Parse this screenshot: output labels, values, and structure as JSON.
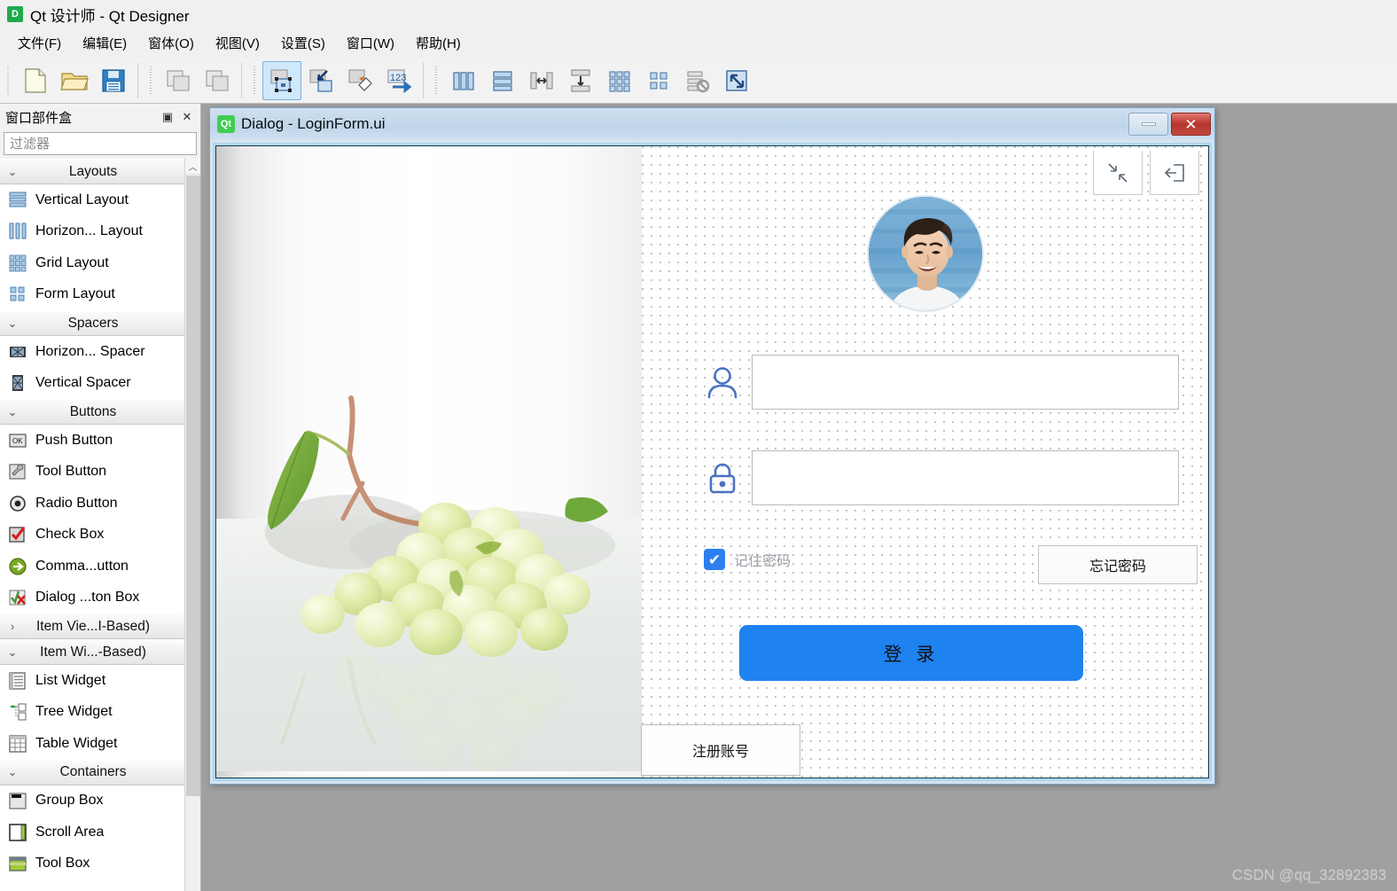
{
  "window": {
    "app_icon": "D",
    "title": "Qt 设计师 - Qt Designer"
  },
  "menubar": {
    "items": [
      {
        "label": "文件(F)",
        "name": "menu-file"
      },
      {
        "label": "编辑(E)",
        "name": "menu-edit"
      },
      {
        "label": "窗体(O)",
        "name": "menu-form"
      },
      {
        "label": "视图(V)",
        "name": "menu-view"
      },
      {
        "label": "设置(S)",
        "name": "menu-settings"
      },
      {
        "label": "窗口(W)",
        "name": "menu-window"
      },
      {
        "label": "帮助(H)",
        "name": "menu-help"
      }
    ]
  },
  "toolbar": {
    "groups": [
      {
        "buttons": [
          "new-file-icon",
          "open-file-icon",
          "save-file-icon"
        ]
      },
      {
        "buttons": [
          "copy-icon",
          "paste-icon"
        ]
      },
      {
        "buttons": [
          "edit-widgets-icon",
          "edit-signals-slots-icon",
          "edit-buddies-icon",
          "edit-tab-order-icon"
        ]
      },
      {
        "buttons": [
          "layout-horizontally-icon",
          "layout-vertically-icon",
          "layout-splitter-horizontal-icon",
          "layout-splitter-vertical-icon",
          "layout-grid-icon",
          "layout-form-icon",
          "break-layout-icon",
          "adjust-size-icon"
        ]
      }
    ]
  },
  "widget_box": {
    "title": "窗口部件盒",
    "float_button": "▣",
    "close_button": "✕",
    "filter_placeholder": "过滤器",
    "filter_value": "",
    "scroll_up_arrow": "︿",
    "groups": [
      {
        "label": "Layouts",
        "expanded": true,
        "arrow": "⌄",
        "items": [
          {
            "label": "Vertical Layout",
            "icon": "vertical-layout-icon"
          },
          {
            "label": "Horizon... Layout",
            "icon": "horizontal-layout-icon"
          },
          {
            "label": "Grid Layout",
            "icon": "grid-layout-icon"
          },
          {
            "label": "Form Layout",
            "icon": "form-layout-icon"
          }
        ]
      },
      {
        "label": "Spacers",
        "expanded": true,
        "arrow": "⌄",
        "items": [
          {
            "label": "Horizon... Spacer",
            "icon": "horizontal-spacer-icon"
          },
          {
            "label": "Vertical Spacer",
            "icon": "vertical-spacer-icon"
          }
        ]
      },
      {
        "label": "Buttons",
        "expanded": true,
        "arrow": "⌄",
        "items": [
          {
            "label": "Push Button",
            "icon": "push-button-icon"
          },
          {
            "label": "Tool Button",
            "icon": "tool-button-icon"
          },
          {
            "label": "Radio Button",
            "icon": "radio-button-icon"
          },
          {
            "label": "Check Box",
            "icon": "check-box-icon"
          },
          {
            "label": "Comma...utton",
            "icon": "command-link-button-icon"
          },
          {
            "label": "Dialog ...ton Box",
            "icon": "dialog-button-box-icon"
          }
        ]
      },
      {
        "label": "Item Vie...I-Based)",
        "expanded": false,
        "arrow": "›",
        "items": []
      },
      {
        "label": "Item Wi...-Based)",
        "expanded": true,
        "arrow": "⌄",
        "items": [
          {
            "label": "List Widget",
            "icon": "list-widget-icon"
          },
          {
            "label": "Tree Widget",
            "icon": "tree-widget-icon"
          },
          {
            "label": "Table Widget",
            "icon": "table-widget-icon"
          }
        ]
      },
      {
        "label": "Containers",
        "expanded": true,
        "arrow": "⌄",
        "items": [
          {
            "label": "Group Box",
            "icon": "group-box-icon"
          },
          {
            "label": "Scroll Area",
            "icon": "scroll-area-icon"
          },
          {
            "label": "Tool Box",
            "icon": "tool-box-icon"
          }
        ]
      }
    ]
  },
  "dialog": {
    "badge": "Qt",
    "title": "Dialog - LoginForm.ui",
    "minimize_label": "",
    "close_label": "✕"
  },
  "login_form": {
    "corner_buttons": [
      {
        "name": "minimize-window-icon",
        "label": ""
      },
      {
        "name": "exit-icon",
        "label": ""
      }
    ],
    "avatar_alt": "user-avatar",
    "username": {
      "value": "",
      "placeholder": "",
      "icon": "user-icon"
    },
    "password": {
      "value": "",
      "placeholder": "",
      "icon": "lock-icon"
    },
    "remember": {
      "label": "记住密码",
      "checked": true,
      "tick": "✔"
    },
    "forgot_password_label": "忘记密码",
    "login_label": "登 录",
    "register_label": "注册账号"
  },
  "watermark": "CSDN @qq_32892383",
  "colors": {
    "accent_blue": "#1e82f0",
    "checkbox_blue": "#2d7ff0",
    "icon_blue": "#4a72c4",
    "qt_green": "#41cd52",
    "selection_border": "#aed6f1",
    "mdi_background": "#a0a0a0"
  }
}
